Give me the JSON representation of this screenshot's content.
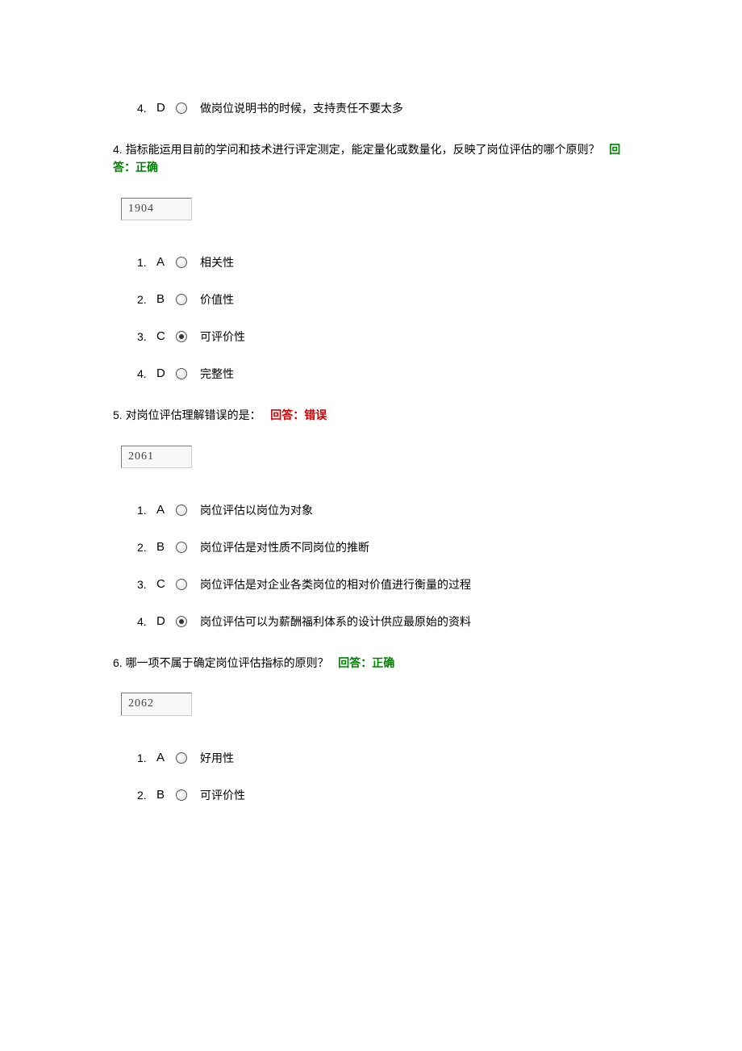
{
  "topOption": {
    "num": "4.",
    "letter": "D",
    "selected": false,
    "text": "做岗位说明书的时候，支持责任不要太多"
  },
  "questions": [
    {
      "num": "4.",
      "text": "指标能运用目前的学问和技术进行评定测定，能定量化或数量化，反映了岗位评估的哪个原则？",
      "answerPrefix": "回答：",
      "answerStatus": "正确",
      "answerClass": "ans-correct",
      "idValue": "1904",
      "options": [
        {
          "num": "1.",
          "letter": "A",
          "selected": false,
          "text": "相关性"
        },
        {
          "num": "2.",
          "letter": "B",
          "selected": false,
          "text": "价值性"
        },
        {
          "num": "3.",
          "letter": "C",
          "selected": true,
          "text": "可评价性"
        },
        {
          "num": "4.",
          "letter": "D",
          "selected": false,
          "text": "完整性"
        }
      ]
    },
    {
      "num": "5.",
      "text": "对岗位评估理解错误的是：",
      "answerPrefix": "回答：",
      "answerStatus": "错误",
      "answerClass": "ans-wrong",
      "idValue": "2061",
      "options": [
        {
          "num": "1.",
          "letter": "A",
          "selected": false,
          "text": "岗位评估以岗位为对象"
        },
        {
          "num": "2.",
          "letter": "B",
          "selected": false,
          "text": "岗位评估是对性质不同岗位的推断"
        },
        {
          "num": "3.",
          "letter": "C",
          "selected": false,
          "text": "岗位评估是对企业各类岗位的相对价值进行衡量的过程"
        },
        {
          "num": "4.",
          "letter": "D",
          "selected": true,
          "text": "岗位评估可以为薪酬福利体系的设计供应最原始的资料"
        }
      ]
    },
    {
      "num": "6.",
      "text": "哪一项不属于确定岗位评估指标的原则？",
      "answerPrefix": "回答：",
      "answerStatus": "正确",
      "answerClass": "ans-correct",
      "idValue": "2062",
      "options": [
        {
          "num": "1.",
          "letter": "A",
          "selected": false,
          "text": "好用性"
        },
        {
          "num": "2.",
          "letter": "B",
          "selected": false,
          "text": "可评价性"
        }
      ]
    }
  ]
}
